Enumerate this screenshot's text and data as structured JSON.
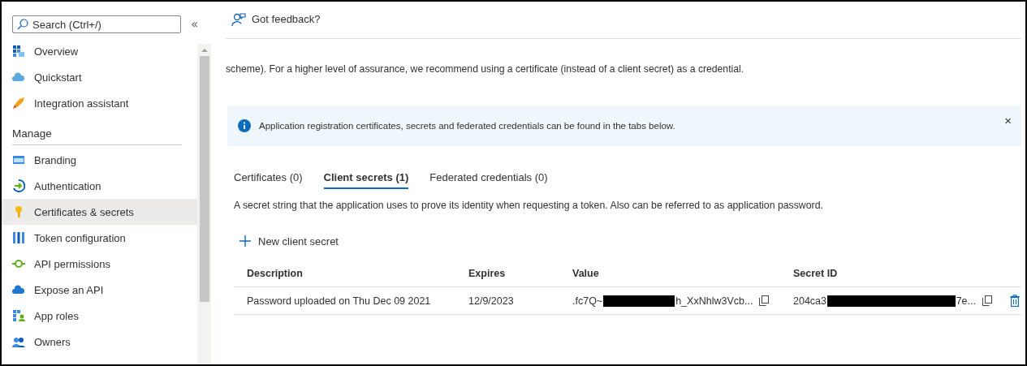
{
  "sidebar": {
    "search": {
      "placeholder": "Search (Ctrl+/)"
    },
    "collapse": "«",
    "items": [
      {
        "label": "Overview",
        "selected": false
      },
      {
        "label": "Quickstart",
        "selected": false
      },
      {
        "label": "Integration assistant",
        "selected": false
      }
    ],
    "section": {
      "title": "Manage",
      "items": [
        {
          "label": "Branding",
          "selected": false
        },
        {
          "label": "Authentication",
          "selected": false
        },
        {
          "label": "Certificates & secrets",
          "selected": true
        },
        {
          "label": "Token configuration",
          "selected": false
        },
        {
          "label": "API permissions",
          "selected": false
        },
        {
          "label": "Expose an API",
          "selected": false
        },
        {
          "label": "App roles",
          "selected": false
        },
        {
          "label": "Owners",
          "selected": false
        }
      ]
    }
  },
  "toolbar": {
    "feedback": "Got feedback?"
  },
  "intro": "scheme). For a higher level of assurance, we recommend using a certificate (instead of a client secret) as a credential.",
  "banner": {
    "text": "Application registration certificates, secrets and federated credentials can be found in the tabs below.",
    "close": "×"
  },
  "tabs": [
    {
      "label": "Certificates (0)",
      "selected": false
    },
    {
      "label": "Client secrets (1)",
      "selected": true
    },
    {
      "label": "Federated credentials (0)",
      "selected": false
    }
  ],
  "description": "A secret string that the application uses to prove its identity when requesting a token. Also can be referred to as application password.",
  "new_button": "New client secret",
  "table": {
    "columns": [
      "Description",
      "Expires",
      "Value",
      "Secret ID"
    ],
    "rows": [
      {
        "description": "Password uploaded on Thu Dec 09 2021",
        "expires": "12/9/2023",
        "value_start": ".fc7Q~",
        "value_end": "h_XxNhlw3Vcb...",
        "id_start": "204ca3",
        "id_end": "7e..."
      }
    ]
  }
}
